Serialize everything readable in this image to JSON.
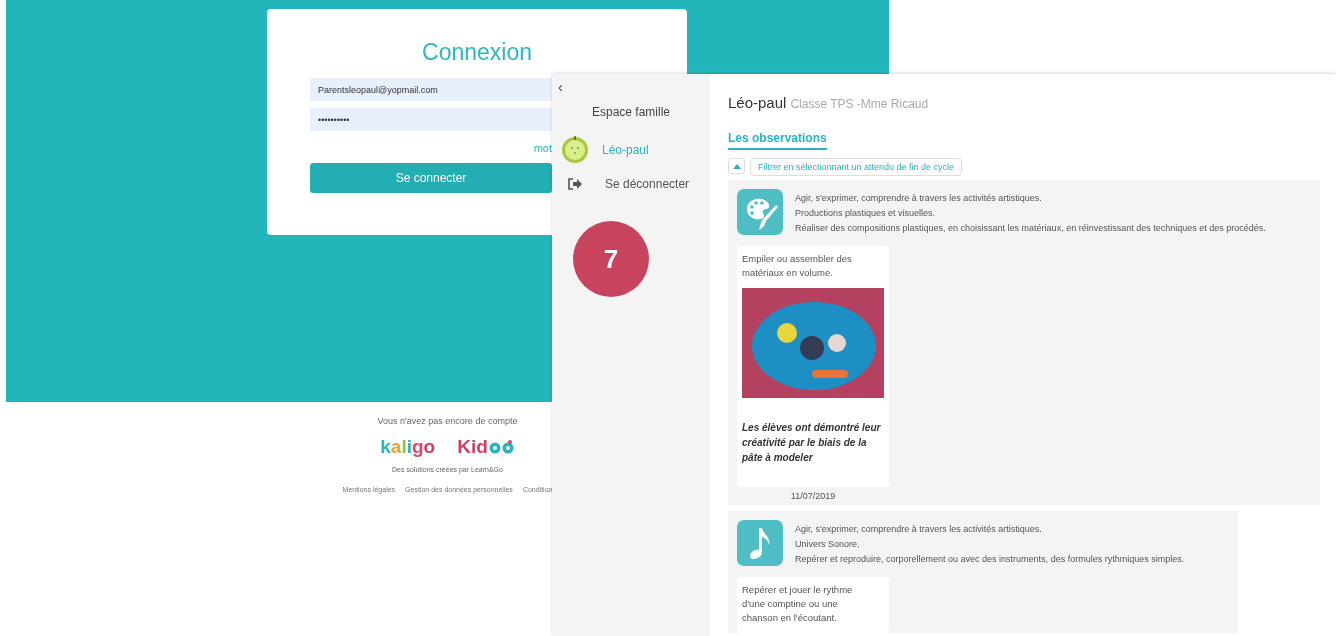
{
  "login": {
    "title": "Connexion",
    "email": "Parentsleopaul@yopmail.com",
    "password": "••••••••••",
    "forgot_link": "mot",
    "submit": "Se connecter"
  },
  "footer": {
    "question": "Vous n'avez pas encore de compte",
    "logos": [
      "kaligo",
      "Kid"
    ],
    "tagline": "Des solutions créées par Learn&Go",
    "links": [
      "Mentions légales",
      "Gestion des données personnelles",
      "Condition"
    ]
  },
  "badge": "7",
  "app": {
    "back": "‹",
    "sidebar": {
      "title": "Espace famille",
      "items": [
        {
          "kind": "child",
          "label": "Léo-paul",
          "selected": true
        },
        {
          "kind": "logout",
          "label": "Se déconnecter",
          "selected": false
        }
      ]
    },
    "student": {
      "name": "Léo-paul",
      "class": "Classe TPS -Mme Ricaud"
    },
    "tabs": [
      {
        "label": "Les observations",
        "selected": true
      }
    ],
    "filter": {
      "label": "Filtrer en sélectionnant un attendu de fin de cycle",
      "expanded": true
    },
    "observations": [
      {
        "kind": "palette",
        "lines": [
          "Agir, s'exprimer, comprendre à travers les activités artistiques.",
          "Productions plastiques et visuelles.",
          "Réaliser des compositions plastiques, en choisissant les matériaux, en réinvestissant des techniques et des procédés."
        ],
        "cards": [
          {
            "title": "Empiler ou assembler des matériaux en volume.",
            "photo": true,
            "comment": "Les élèves ont démontré leur créativité par le biais de la pâte à modeler",
            "date": "11/07/2019"
          }
        ]
      },
      {
        "kind": "music",
        "lines": [
          "Agir, s'exprimer, comprendre à travers les activités artistiques.",
          "Univers Sonore.",
          "Repérer et reproduire, corporellement ou avec des instruments, des formules rythmiques simples."
        ],
        "cards": [
          {
            "title": "Repérer et jouer le rythme d'une comptine ou une chanson en l'écoutant.",
            "photo": false
          }
        ]
      }
    ]
  }
}
